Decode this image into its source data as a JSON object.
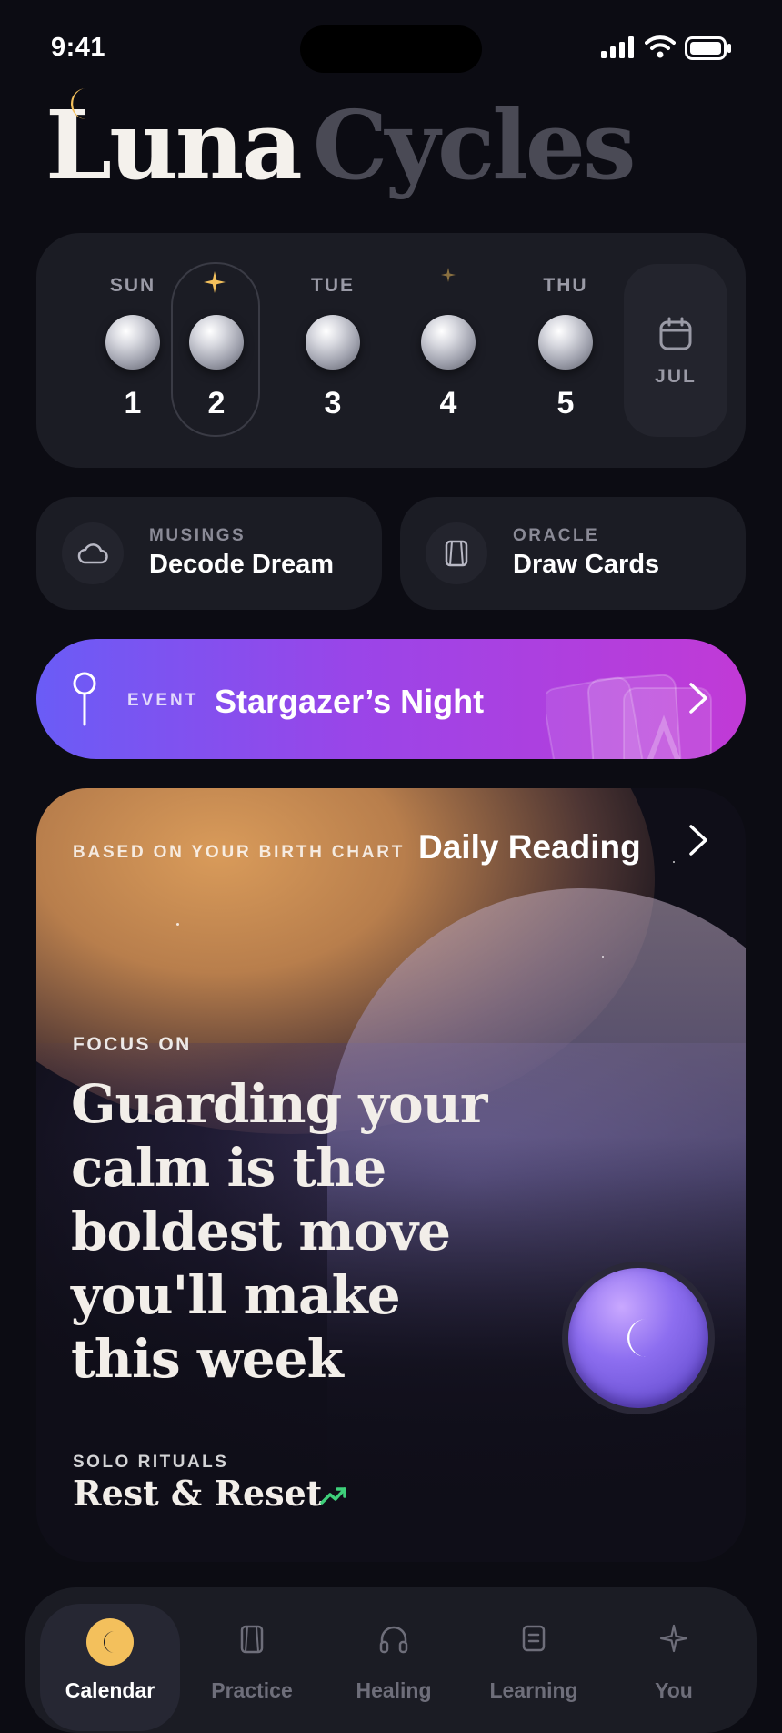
{
  "status_bar": {
    "time": "9:41"
  },
  "app": {
    "title_part1": "Luna",
    "title_part2": "Cycles"
  },
  "week": {
    "days": [
      {
        "name": "SUN",
        "number": "1"
      },
      {
        "name": "",
        "number": "2"
      },
      {
        "name": "TUE",
        "number": "3"
      },
      {
        "name": "",
        "number": "4"
      },
      {
        "name": "THU",
        "number": "5"
      }
    ],
    "selected_index": 1,
    "month": "JUL"
  },
  "shortcuts": [
    {
      "kicker": "MUSINGS",
      "label": "Decode Dream",
      "icon": "cloud-icon"
    },
    {
      "kicker": "ORACLE",
      "label": "Draw Cards",
      "icon": "cards-icon"
    }
  ],
  "event": {
    "kicker": "EVENT",
    "title": "Stargazer’s Night"
  },
  "reading": {
    "kicker": "BASED ON YOUR BIRTH CHART",
    "title": "Daily Reading",
    "focus_kicker": "FOCUS ON",
    "quote": "Guarding your calm is the boldest move you'll make this week",
    "ritual_kicker": "SOLO RITUALS",
    "ritual_title": "Rest & Reset"
  },
  "tabs": [
    {
      "label": "Calendar",
      "icon": "moon-icon",
      "active": true
    },
    {
      "label": "Practice",
      "icon": "cards-icon",
      "active": false
    },
    {
      "label": "Healing",
      "icon": "headphones-icon",
      "active": false
    },
    {
      "label": "Learning",
      "icon": "note-icon",
      "active": false
    },
    {
      "label": "You",
      "icon": "sparkle-icon",
      "active": false
    }
  ],
  "colors": {
    "accent_gold": "#f3c05c",
    "event_start": "#6a5cf6",
    "event_end": "#c13ad6",
    "trend_green": "#3ecf7a"
  }
}
